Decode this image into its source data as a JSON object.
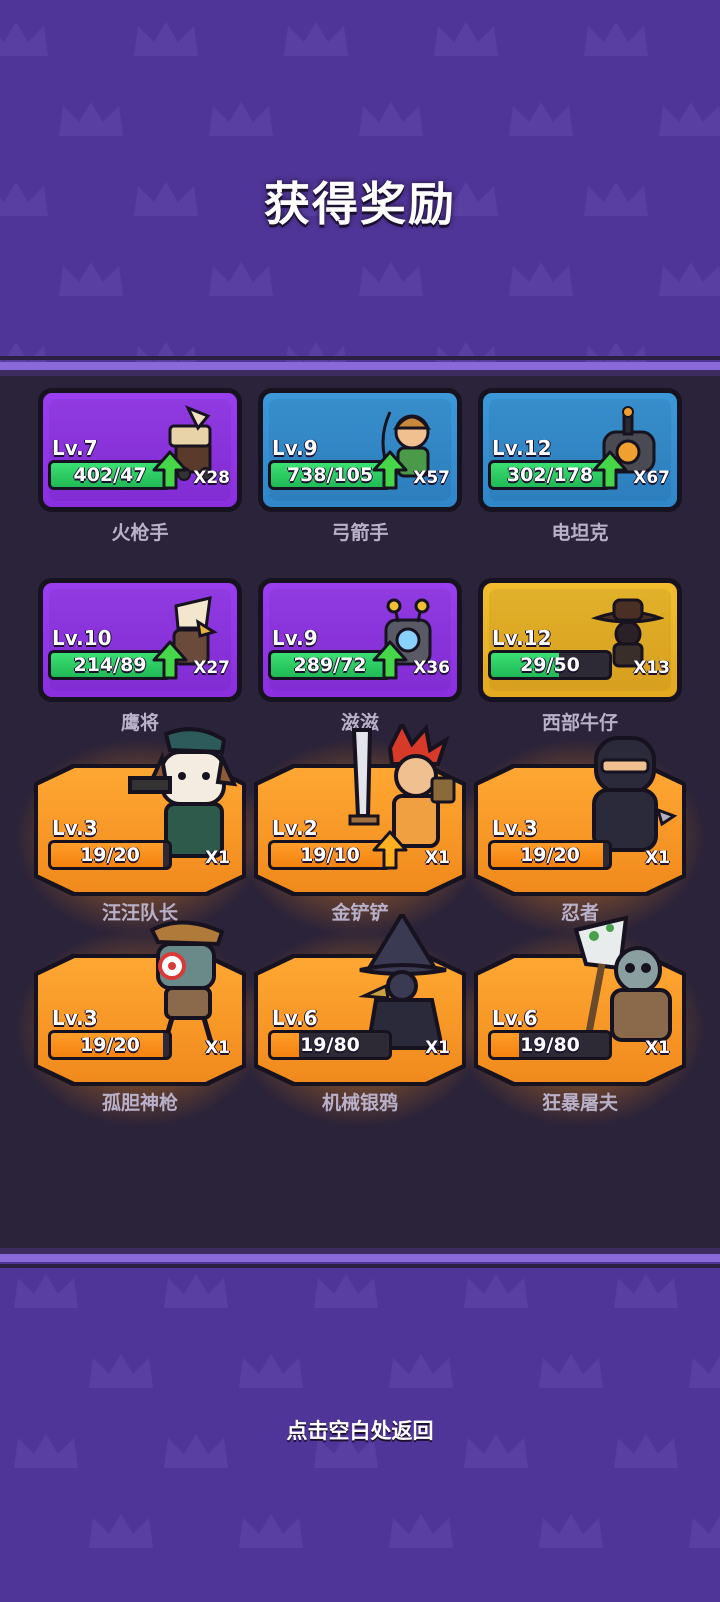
{
  "title": "获得奖励",
  "footer_hint": "点击空白处返回",
  "colors": {
    "background": "#4f3597",
    "panel": "#2b2339",
    "purple_card": "#8a2ee0",
    "blue_card": "#2f86c9",
    "gold_card": "#e4a91f",
    "orange_card": "#f08a1c",
    "progress_green": "#20b956"
  },
  "rewards": [
    {
      "name": "火枪手",
      "level": "Lv.7",
      "progress": "402/47",
      "count": "X28",
      "rarity": "purple",
      "upgradable": true,
      "icon": "musketeer-icon"
    },
    {
      "name": "弓箭手",
      "level": "Lv.9",
      "progress": "738/105",
      "count": "X57",
      "rarity": "blue",
      "upgradable": true,
      "icon": "archer-icon"
    },
    {
      "name": "电坦克",
      "level": "Lv.12",
      "progress": "302/178",
      "count": "X67",
      "rarity": "blue",
      "upgradable": true,
      "icon": "electric-tank-icon"
    },
    {
      "name": "鹰将",
      "level": "Lv.10",
      "progress": "214/89",
      "count": "X27",
      "rarity": "purple",
      "upgradable": true,
      "icon": "eagle-general-icon"
    },
    {
      "name": "滋滋",
      "level": "Lv.9",
      "progress": "289/72",
      "count": "X36",
      "rarity": "purple",
      "upgradable": true,
      "icon": "zizi-robot-icon"
    },
    {
      "name": "西部牛仔",
      "level": "Lv.12",
      "progress": "29/50",
      "count": "X13",
      "rarity": "gold",
      "upgradable": false,
      "icon": "cowboy-icon"
    },
    {
      "name": "汪汪队长",
      "level": "Lv.3",
      "progress": "19/20",
      "count": "X1",
      "rarity": "orange",
      "upgradable": false,
      "icon": "dog-captain-icon"
    },
    {
      "name": "金铲铲",
      "level": "Lv.2",
      "progress": "19/10",
      "count": "X1",
      "rarity": "orange",
      "upgradable": true,
      "icon": "golden-shovel-icon"
    },
    {
      "name": "忍者",
      "level": "Lv.3",
      "progress": "19/20",
      "count": "X1",
      "rarity": "orange",
      "upgradable": false,
      "icon": "ninja-icon"
    },
    {
      "name": "孤胆神枪",
      "level": "Lv.3",
      "progress": "19/20",
      "count": "X1",
      "rarity": "orange",
      "upgradable": false,
      "icon": "lone-gunner-icon"
    },
    {
      "name": "机械银鸦",
      "level": "Lv.6",
      "progress": "19/80",
      "count": "X1",
      "rarity": "orange",
      "upgradable": false,
      "icon": "silver-crow-icon"
    },
    {
      "name": "狂暴屠夫",
      "level": "Lv.6",
      "progress": "19/80",
      "count": "X1",
      "rarity": "orange",
      "upgradable": false,
      "icon": "berserk-butcher-icon"
    }
  ]
}
